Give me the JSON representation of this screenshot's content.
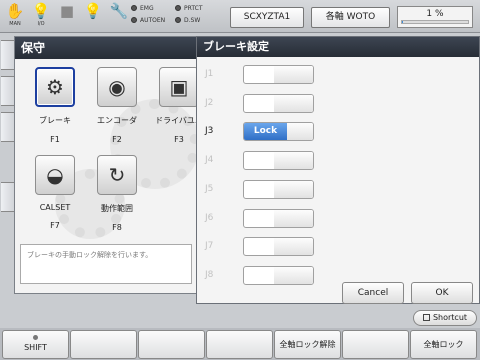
{
  "topbar": {
    "icons": [
      {
        "icon": "hand-icon",
        "label": "MAN"
      },
      {
        "icon": "io-icon",
        "label": "I/O"
      },
      {
        "icon": "stop-square-icon",
        "label": ""
      },
      {
        "icon": "bulb-icon",
        "label": ""
      },
      {
        "icon": "wrench-icon",
        "label": ""
      }
    ],
    "lamps": {
      "emg": "EMG",
      "prtct": "PRTCT",
      "autoen": "AUTOEN",
      "dsw": "D.SW"
    },
    "robot_button": "SCXYZTA1",
    "axis_button": "各軸  WOTO",
    "progress_text": "1 %",
    "progress_value": 0.01
  },
  "maintenance": {
    "title": "保守",
    "functions": [
      {
        "name": "ブレーキ",
        "key": "F1",
        "icon": "brake-icon",
        "selected": true
      },
      {
        "name": "エンコーダ",
        "key": "F2",
        "icon": "encoder-icon",
        "selected": false
      },
      {
        "name": "ドライバユニ",
        "key": "F3",
        "icon": "driver-unit-icon",
        "selected": false
      },
      {
        "name": "CALSET",
        "key": "F7",
        "icon": "calset-icon",
        "selected": false
      },
      {
        "name": "動作範囲",
        "key": "F8",
        "icon": "motion-range-icon",
        "selected": false
      }
    ],
    "description": "ブレーキの手動ロック解除を行います。"
  },
  "brake_dialog": {
    "title": "ブレーキ設定",
    "axes": [
      {
        "label": "J1",
        "state": ""
      },
      {
        "label": "J2",
        "state": ""
      },
      {
        "label": "J3",
        "state": "Lock"
      },
      {
        "label": "J4",
        "state": ""
      },
      {
        "label": "J5",
        "state": ""
      },
      {
        "label": "J6",
        "state": ""
      },
      {
        "label": "J7",
        "state": ""
      },
      {
        "label": "J8",
        "state": ""
      }
    ],
    "cancel": "Cancel",
    "ok": "OK"
  },
  "shortcut": "Shortcut",
  "bottombar": {
    "shift": "SHIFT",
    "release_all": "全軸ロック解除",
    "lock_all": "全軸ロック"
  }
}
